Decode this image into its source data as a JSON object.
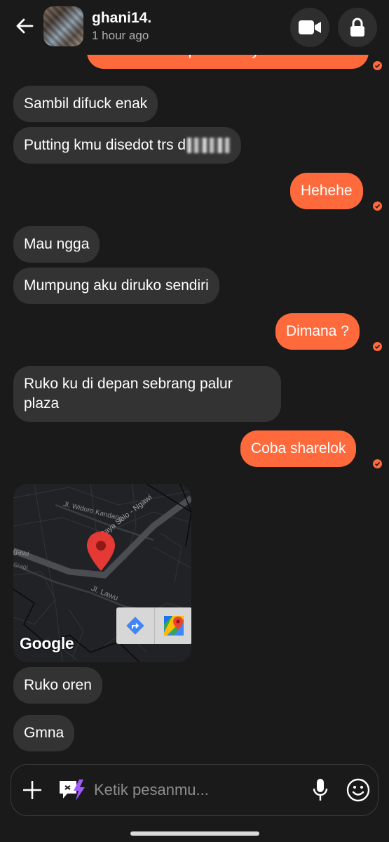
{
  "header": {
    "username": "ghani14.",
    "last_seen": "1 hour ago",
    "icons": {
      "back": "arrow-left-icon",
      "video": "video-camera-icon",
      "lock": "lock-icon"
    }
  },
  "messages": [
    {
      "side": "out",
      "text": "akses ke foto pribadi saya.",
      "read": true
    },
    {
      "side": "in",
      "text": "Sambil difuck enak"
    },
    {
      "side": "in",
      "text": "Putting kmu disedot trs d",
      "censored": true
    },
    {
      "side": "out",
      "text": "Hehehe",
      "read": true
    },
    {
      "side": "in",
      "text": "Mau ngga"
    },
    {
      "side": "in",
      "text": "Mumpung aku diruko sendiri"
    },
    {
      "side": "out",
      "text": "Dimana ?",
      "read": true
    },
    {
      "side": "in",
      "text_line1": "Ruko ku di depan sebrang palur",
      "text_line2": "plaza"
    },
    {
      "side": "out",
      "text": "Coba sharelok",
      "read": true
    },
    {
      "side": "in",
      "text": "Ruko oren"
    },
    {
      "side": "in",
      "text": "Gmna"
    }
  ],
  "map": {
    "streets": [
      "Jl. Widoro Kandang",
      "Jl. Raya Solo - Ngawi",
      "Jl. Lawu",
      "gawi",
      "Sragi"
    ],
    "brand": "Google",
    "actions": [
      "directions-icon",
      "google-maps-icon"
    ],
    "pin_color": "#e53935"
  },
  "composer": {
    "placeholder": "Ketik pesanmu...",
    "icons": [
      "plus-icon",
      "sticker-icon",
      "microphone-icon",
      "emoji-icon"
    ]
  },
  "colors": {
    "accent": "#ff6a3d",
    "incoming_bubble": "#333333",
    "background": "#1a1a1a"
  }
}
